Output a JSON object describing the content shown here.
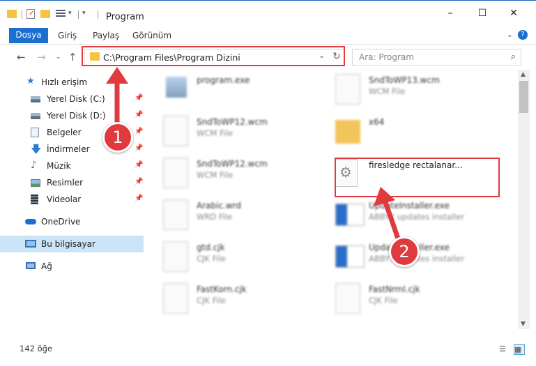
{
  "window": {
    "title": "Program"
  },
  "ribbon": {
    "tabs": [
      "Dosya",
      "Giriş",
      "Paylaş",
      "Görünüm"
    ],
    "help_icon": "?"
  },
  "address": {
    "path": "C:\\Program Files\\Program Dizini"
  },
  "search": {
    "placeholder": "Ara: Program"
  },
  "sidebar": {
    "quick_access": "Hızlı erişim",
    "items": [
      {
        "label": "Yerel Disk (C:)",
        "icon": "drive-icon"
      },
      {
        "label": "Yerel Disk (D:)",
        "icon": "drive-icon"
      },
      {
        "label": "Belgeler",
        "icon": "documents-icon"
      },
      {
        "label": "İndirmeler",
        "icon": "download-icon"
      },
      {
        "label": "Müzik",
        "icon": "music-icon"
      },
      {
        "label": "Resimler",
        "icon": "pictures-icon"
      },
      {
        "label": "Videolar",
        "icon": "videos-icon"
      }
    ],
    "onedrive": "OneDrive",
    "this_pc": "Bu bilgisayar",
    "network": "Ağ"
  },
  "files": {
    "left": [
      {
        "name": "program.exe",
        "desc": ""
      },
      {
        "name": "SndToWP12.wcm",
        "desc": "WCM File"
      },
      {
        "name": "SndToWP12.wcm",
        "desc": "WCM File"
      },
      {
        "name": "Arabic.wrd",
        "desc": "WRD File"
      },
      {
        "name": "gtd.cjk",
        "desc": "CJK File"
      },
      {
        "name": "FastKorn.cjk",
        "desc": "CJK File"
      }
    ],
    "right": [
      {
        "name": "SndToWP13.wcm",
        "desc": "WCM File"
      },
      {
        "name": "x64",
        "desc": ""
      },
      {
        "name": "firesledge rectalanar...",
        "desc": ""
      },
      {
        "name": "UpdateInstaller.exe",
        "desc": "ABBYY updates installer"
      },
      {
        "name": "UpdateInstaller.exe",
        "desc": "ABBYY updates installer"
      },
      {
        "name": "FastNrml.cjk",
        "desc": "CJK File"
      }
    ]
  },
  "status": {
    "count": "142 öğe"
  },
  "annotations": {
    "badge1": "1",
    "badge2": "2"
  },
  "colors": {
    "accent": "#1a6fcf",
    "highlight": "#e0393e",
    "selection": "#cce4f7"
  }
}
